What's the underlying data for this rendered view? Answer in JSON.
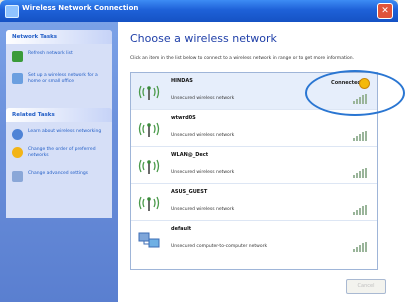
{
  "window": {
    "title": "Wireless Network Connection"
  },
  "sidebar": {
    "network_tasks": {
      "header": "Network Tasks",
      "items": [
        {
          "label": "Refresh network list",
          "icon": "refresh-icon"
        },
        {
          "label": "Set up a wireless network for a home or small office",
          "icon": "setup-network-icon"
        }
      ]
    },
    "related_tasks": {
      "header": "Related Tasks",
      "items": [
        {
          "label": "Learn about wireless networking",
          "icon": "info-icon"
        },
        {
          "label": "Change the order of preferred networks",
          "icon": "star-icon"
        },
        {
          "label": "Change advanced settings",
          "icon": "settings-icon"
        }
      ]
    }
  },
  "main": {
    "heading": "Choose a wireless network",
    "instruction": "Click an item in the list below to connect to a wireless network in range or to get more information.",
    "networks": [
      {
        "name": "HINDAS",
        "description": "Unsecured wireless network",
        "status": "Connected",
        "icon": "wireless-antenna-icon"
      },
      {
        "name": "wtwrd0S",
        "description": "Unsecured wireless network",
        "status": "",
        "icon": "wireless-antenna-icon"
      },
      {
        "name": "WLAN@_Dect",
        "description": "Unsecured wireless network",
        "status": "",
        "icon": "wireless-antenna-icon"
      },
      {
        "name": "ASUS_GUEST",
        "description": "Unsecured wireless network",
        "status": "",
        "icon": "wireless-antenna-icon"
      },
      {
        "name": "default",
        "description": "Unsecured computer-to-computer network",
        "status": "",
        "icon": "computer-to-computer-icon"
      }
    ],
    "cancel_label": "Cancel"
  }
}
